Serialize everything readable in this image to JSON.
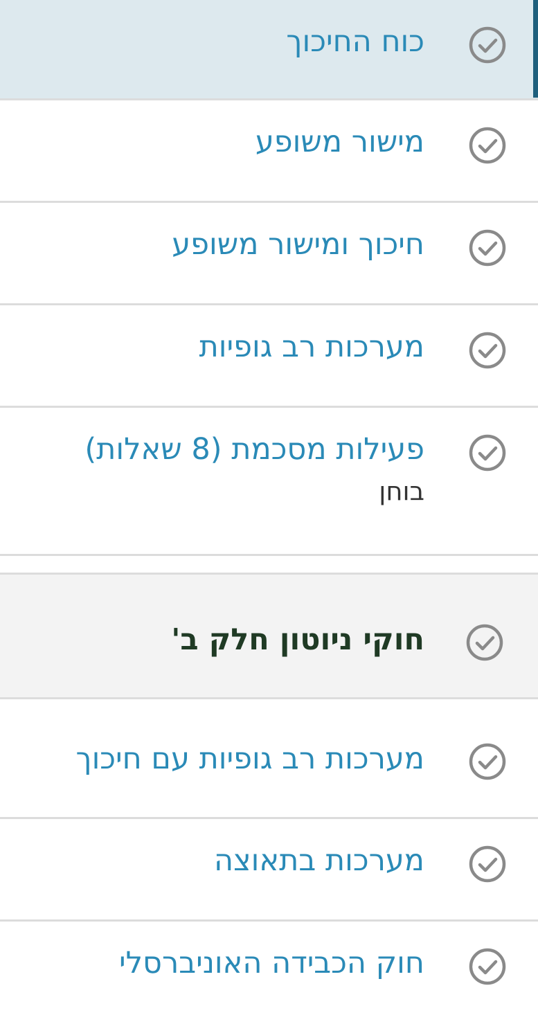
{
  "colors": {
    "link": "#2a8ab7",
    "section_title": "#1f3a24",
    "active_background": "#dde9ee",
    "active_bar": "#1e5f7c",
    "section_background": "#f3f3f3",
    "check_icon": "#8a8a8a"
  },
  "items": [
    {
      "title": "כוח החיכוך",
      "icon": "check-circle-icon",
      "active": true
    },
    {
      "title": "מישור משופע",
      "icon": "check-circle-icon"
    },
    {
      "title": "חיכוך ומישור משופע",
      "icon": "check-circle-icon"
    },
    {
      "title": "מערכות רב גופיות",
      "icon": "check-circle-icon"
    },
    {
      "title": "פעילות מסכמת (8 שאלות)",
      "subtitle": "בוחן",
      "icon": "check-circle-icon"
    }
  ],
  "section": {
    "title": "חוקי ניוטון חלק ב'",
    "icon": "check-circle-icon"
  },
  "section_items": [
    {
      "title": "מערכות רב גופיות עם חיכוך",
      "icon": "check-circle-icon"
    },
    {
      "title": "מערכות בתאוצה",
      "icon": "check-circle-icon"
    },
    {
      "title": "חוק הכבידה האוניברסלי",
      "icon": "check-circle-icon"
    }
  ]
}
